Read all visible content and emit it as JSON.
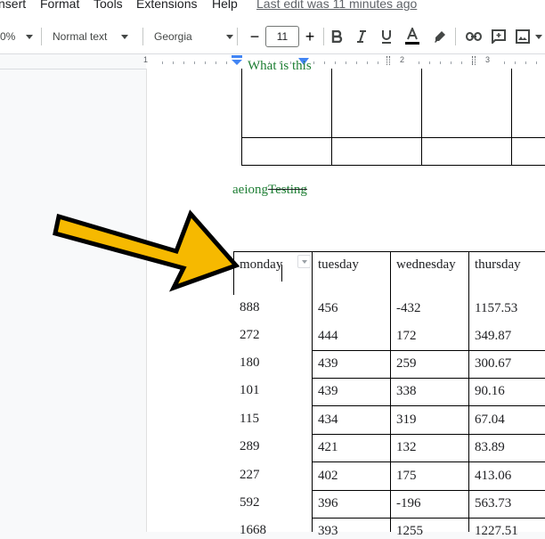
{
  "menu": {
    "items": [
      "nsert",
      "Format",
      "Tools",
      "Extensions",
      "Help"
    ],
    "last_edit": "Last edit was 11 minutes ago"
  },
  "toolbar": {
    "zoom": "0%",
    "style": "Normal text",
    "font": "Georgia",
    "font_size": "11",
    "minus": "−",
    "plus": "+"
  },
  "ruler": {
    "numbers": [
      "1",
      "2",
      "3"
    ]
  },
  "document": {
    "upper_table_text": "What is this",
    "green_text": "aeiong",
    "strike_text": "Testing",
    "table": {
      "headers": [
        "monday",
        "tuesday",
        "wednesday",
        "thursday"
      ],
      "rows": [
        [
          "888",
          "456",
          "-432",
          "1157.53"
        ],
        [
          "272",
          "444",
          "172",
          "349.87"
        ],
        [
          "180",
          "439",
          "259",
          "300.67"
        ],
        [
          "101",
          "439",
          "338",
          "90.16"
        ],
        [
          "115",
          "434",
          "319",
          "67.04"
        ],
        [
          "289",
          "421",
          "132",
          "83.89"
        ],
        [
          "227",
          "402",
          "175",
          "413.06"
        ],
        [
          "592",
          "396",
          "-196",
          "563.73"
        ],
        [
          "1668",
          "393",
          "1255",
          "1227.51"
        ]
      ]
    }
  },
  "colors": {
    "green_text": "#1e7e34",
    "arrow_fill": "#f6b900",
    "ruler_marker": "#4285f4"
  }
}
